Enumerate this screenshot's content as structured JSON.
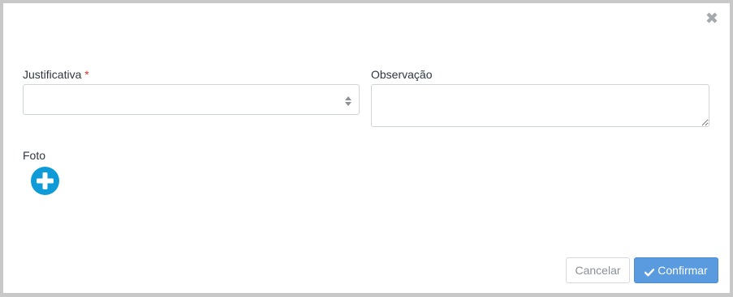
{
  "dialog": {
    "close_icon": "close-icon"
  },
  "justificativa": {
    "label": "Justificativa",
    "required_marker": "*",
    "value": ""
  },
  "observacao": {
    "label": "Observação",
    "value": ""
  },
  "foto": {
    "label": "Foto",
    "add_icon": "plus-circle-icon"
  },
  "actions": {
    "cancel_label": "Cancelar",
    "confirm_label": "Confirmar",
    "confirm_icon": "check-icon"
  },
  "colors": {
    "accent": "#5a9be0",
    "add_button": "#0f9bd7",
    "required": "#d9312a"
  }
}
